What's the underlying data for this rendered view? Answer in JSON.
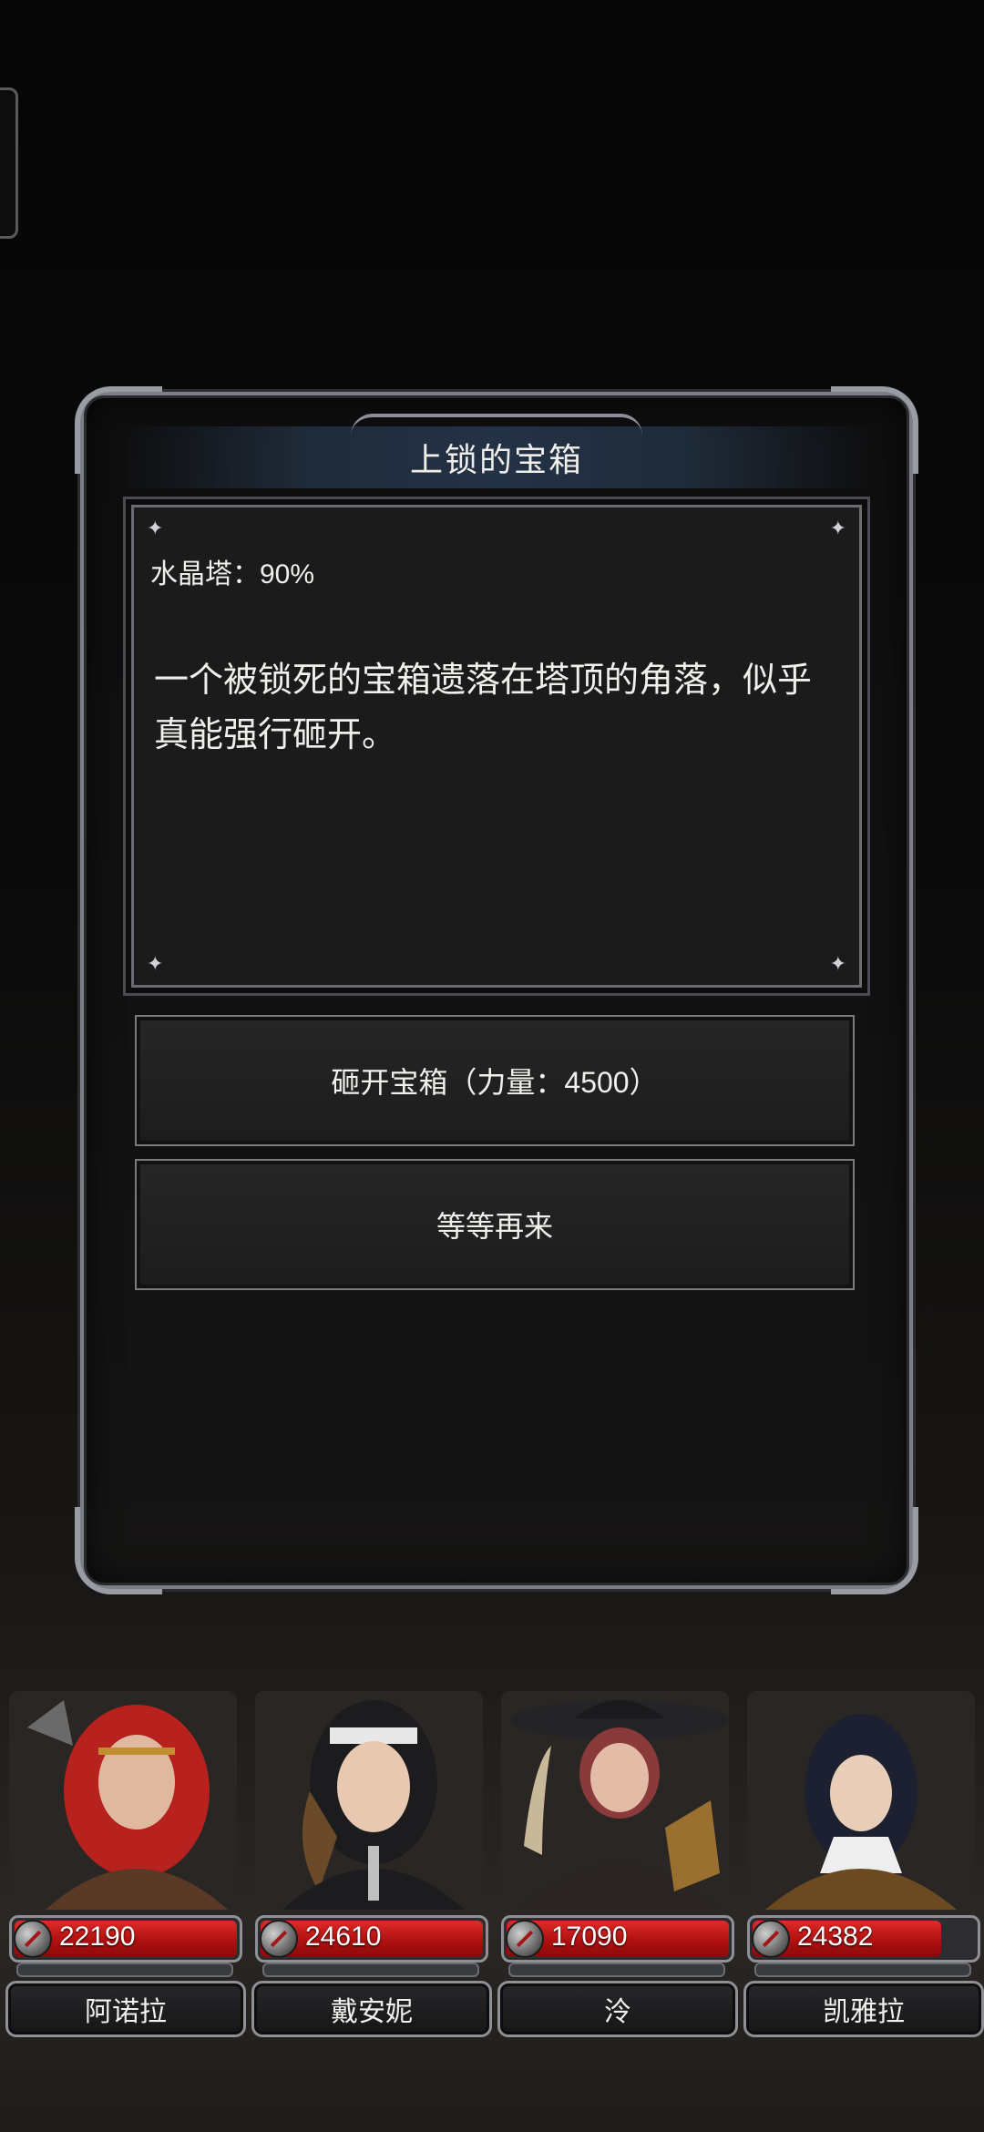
{
  "dialog": {
    "title": "上锁的宝箱",
    "progress_text": "水晶塔：90%",
    "description": "一个被锁死的宝箱遗落在塔顶的角落，似乎真能强行砸开。",
    "choices": [
      {
        "label": "砸开宝箱（力量：4500）"
      },
      {
        "label": "等等再来"
      }
    ]
  },
  "party": [
    {
      "name": "阿诺拉",
      "hp": "22190",
      "hp_fill_fraction": 1.0,
      "portrait_colors": {
        "hair": "#b8221e",
        "cloth": "#5a3a26"
      }
    },
    {
      "name": "戴安妮",
      "hp": "24610",
      "hp_fill_fraction": 1.0,
      "portrait_colors": {
        "hair": "#6b4a2a",
        "cloth": "#1c1c1e"
      }
    },
    {
      "name": "泠",
      "hp": "17090",
      "hp_fill_fraction": 1.0,
      "portrait_colors": {
        "hair": "#8a3a3a",
        "cloth": "#2a2422"
      }
    },
    {
      "name": "凯雅拉",
      "hp": "24382",
      "hp_fill_fraction": 0.85,
      "portrait_colors": {
        "hair": "#1c2030",
        "cloth": "#6b4a22"
      }
    }
  ],
  "icons": {
    "hp": "shield-sword-icon",
    "sparkle": "sparkle-icon"
  }
}
